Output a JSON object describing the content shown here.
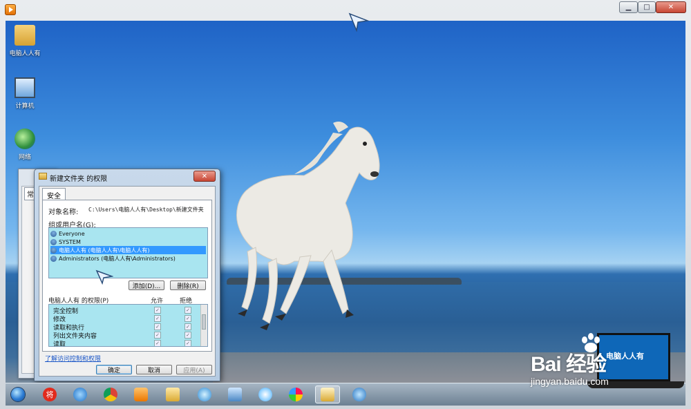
{
  "desktop_icons": [
    {
      "label": "电脑人人有",
      "icon": "user-folder-icon"
    },
    {
      "label": "计算机",
      "icon": "computer-icon"
    },
    {
      "label": "网络",
      "icon": "network-icon"
    }
  ],
  "back_window": {
    "tab_label": "常"
  },
  "dialog": {
    "title": "新建文件夹 的权限",
    "close_label": "✕",
    "tab": "安全",
    "object_name_label": "对象名称:",
    "object_name_value": "C:\\Users\\电脑人人有\\Desktop\\新建文件夹",
    "group_label": "组或用户名(G):",
    "users": [
      {
        "label": "Everyone",
        "selected": false
      },
      {
        "label": "SYSTEM",
        "selected": false
      },
      {
        "label": "电脑人人有 (电脑人人有\\电脑人人有)",
        "selected": true
      },
      {
        "label": "Administrators (电脑人人有\\Administrators)",
        "selected": false
      }
    ],
    "add_label": "添加(D)...",
    "remove_label": "删除(R)",
    "permissions_label": "电脑人人有 的权限(P)",
    "allow_label": "允许",
    "deny_label": "拒绝",
    "permissions": [
      {
        "name": "完全控制",
        "allow": true,
        "deny": true
      },
      {
        "name": "修改",
        "allow": true,
        "deny": true
      },
      {
        "name": "读取和执行",
        "allow": true,
        "deny": true
      },
      {
        "name": "列出文件夹内容",
        "allow": true,
        "deny": true
      },
      {
        "name": "读取",
        "allow": true,
        "deny": true
      }
    ],
    "advanced_link": "了解访问控制和权限",
    "ok_label": "确定",
    "cancel_label": "取消",
    "apply_label": "应用(A)"
  },
  "window_buttons": {
    "minimize": "▁",
    "maximize": "□",
    "close": "✕"
  },
  "taskbar": {
    "items": [
      {
        "icon": "windows-start-icon"
      },
      {
        "icon": "jiang-app-icon",
        "text": "将"
      },
      {
        "icon": "ie-browser-icon"
      },
      {
        "icon": "chrome-browser-icon"
      },
      {
        "icon": "media-player-icon"
      },
      {
        "icon": "folder-icon"
      },
      {
        "icon": "360-browser-icon"
      },
      {
        "icon": "monitor-icon"
      },
      {
        "icon": "flower-app-icon"
      },
      {
        "icon": "paint-icon"
      },
      {
        "icon": "file-explorer-icon"
      },
      {
        "icon": "tool-icon"
      }
    ]
  },
  "watermark": {
    "brand": "Bai 经验",
    "url": "jingyan.baidu.com",
    "screen_text": "电脑人人有"
  },
  "colors": {
    "accent": "#3399ff",
    "list_bg": "#a9e5f0",
    "sky": "#3d8ddd",
    "sea": "#24598f"
  }
}
